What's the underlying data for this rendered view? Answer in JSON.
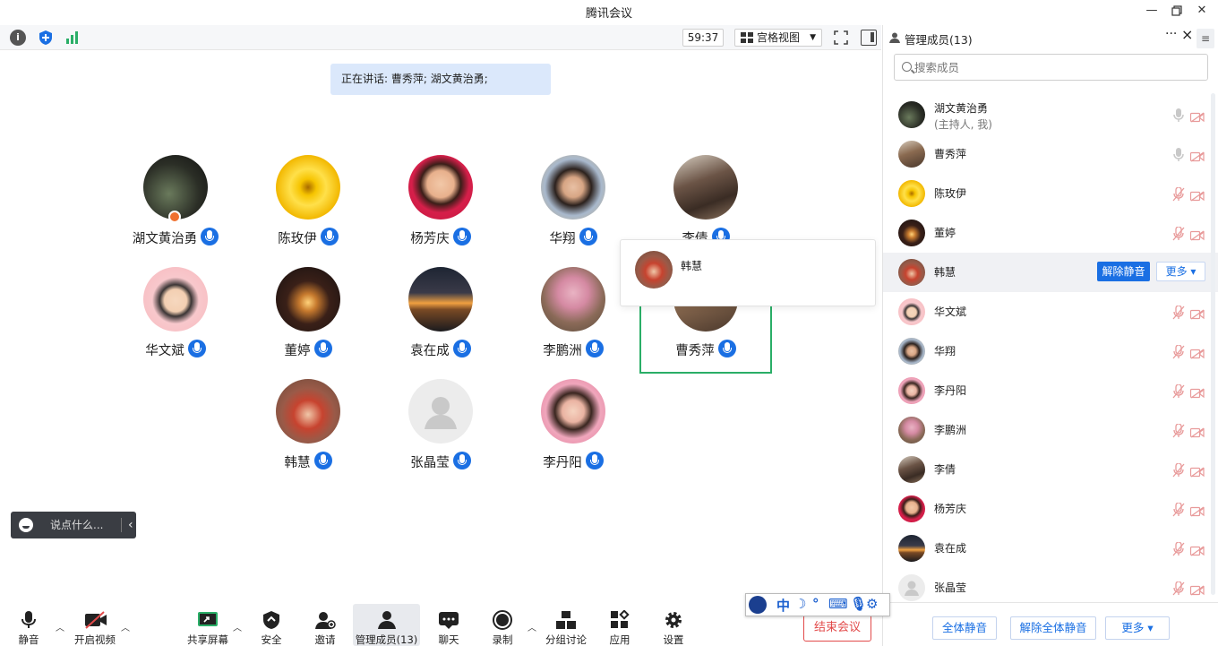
{
  "window": {
    "title": "腾讯会议"
  },
  "video_toolbar": {
    "timer": "59:37",
    "view_mode": "宫格视图"
  },
  "speaking_banner": "正在讲话: 曹秀萍; 湖文黄治勇;",
  "grid": [
    {
      "name": "湖文黄治勇",
      "avatar": "photo-dark-robot",
      "host": true
    },
    {
      "name": "陈玫伊",
      "avatar": "sunflowers"
    },
    {
      "name": "杨芳庆",
      "avatar": "cartoon-woman-red"
    },
    {
      "name": "华翔",
      "avatar": "woman-glasses"
    },
    {
      "name": "李倩",
      "avatar": "room-photo"
    },
    {
      "name": "华文斌",
      "avatar": "cartoon-man-glasses"
    },
    {
      "name": "董婷",
      "avatar": "night-girl-lantern"
    },
    {
      "name": "袁在成",
      "avatar": "sunset-sea"
    },
    {
      "name": "李鹏洲",
      "avatar": "peach-blossom-man"
    },
    {
      "name": "曹秀萍",
      "avatar": "room-photo-2",
      "selected": true
    },
    {
      "name": "韩慧",
      "avatar": "two-kids"
    },
    {
      "name": "张晶莹",
      "avatar": "default-user"
    },
    {
      "name": "李丹阳",
      "avatar": "woman-flowers"
    }
  ],
  "popup": {
    "name": "韩慧"
  },
  "chat": {
    "placeholder": "说点什么..."
  },
  "panel": {
    "title": "管理成员(13)",
    "search_placeholder": "搜索成员",
    "members": [
      {
        "name": "湖文黄治勇",
        "sub": "(主持人, 我)",
        "mic": "on"
      },
      {
        "name": "曹秀萍",
        "mic": "on"
      },
      {
        "name": "陈玫伊",
        "mic": "muted"
      },
      {
        "name": "董婷",
        "mic": "muted"
      },
      {
        "name": "韩慧",
        "mic": "muted",
        "highlight": true,
        "unmute_label": "解除静音",
        "more_label": "更多 ▾"
      },
      {
        "name": "华文斌",
        "mic": "muted"
      },
      {
        "name": "华翔",
        "mic": "muted"
      },
      {
        "name": "李丹阳",
        "mic": "muted"
      },
      {
        "name": "李鹏洲",
        "mic": "muted"
      },
      {
        "name": "李倩",
        "mic": "muted"
      },
      {
        "name": "杨芳庆",
        "mic": "muted"
      },
      {
        "name": "袁在成",
        "mic": "muted"
      },
      {
        "name": "张晶莹",
        "mic": "muted"
      }
    ],
    "footer": {
      "mute_all": "全体静音",
      "unmute_all": "解除全体静音",
      "more": "更多 ▾"
    }
  },
  "toolbar": {
    "mute": "静音",
    "video": "开启视频",
    "share": "共享屏幕",
    "security": "安全",
    "invite": "邀请",
    "members": "管理成员(13)",
    "chat": "聊天",
    "record": "录制",
    "breakout": "分组讨论",
    "apps": "应用",
    "settings": "设置",
    "end": "结束会议"
  },
  "colors": {
    "accent": "#1a6fe3",
    "end_red": "#e24a4a",
    "active_green": "#2aae67"
  }
}
